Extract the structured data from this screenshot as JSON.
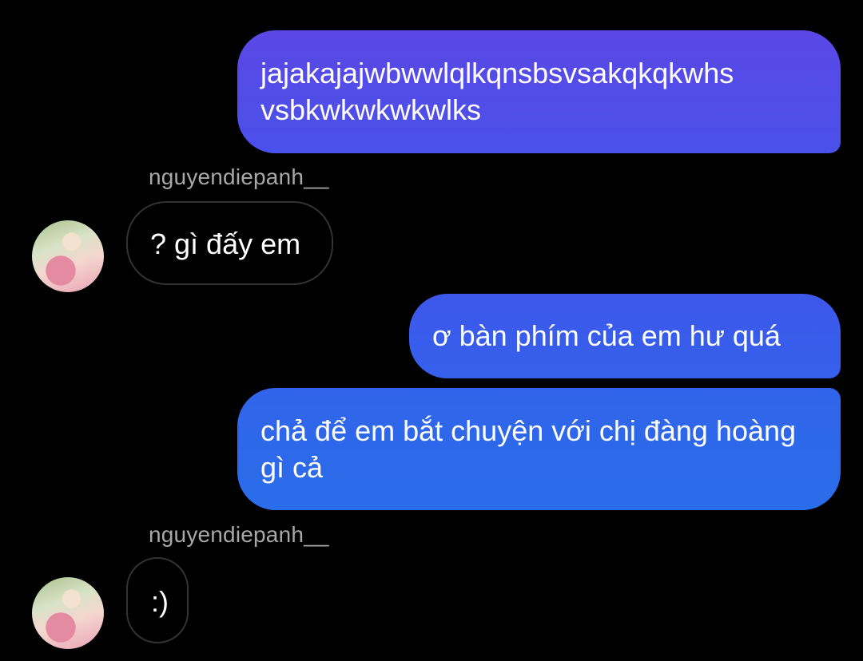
{
  "colors": {
    "background": "#000000",
    "sent_gradient_top": "#5a48e6",
    "sent_gradient_mid": "#3c57ec",
    "sent_gradient_bottom": "#2b6bea",
    "received_border": "#333336",
    "sender_name": "#a8a8a8",
    "text": "#ffffff"
  },
  "messages": [
    {
      "direction": "sent",
      "text": "jajakajajwbwwlqlkqnsbsvsakqkqkwhs vsbkwkwkwkwlks"
    },
    {
      "direction": "received",
      "sender": "nguyendiepanh__",
      "text": "? gì đấy em"
    },
    {
      "direction": "sent",
      "text": "ơ bàn phím của em hư quá"
    },
    {
      "direction": "sent",
      "text": "chả để em bắt chuyện với chị đàng hoàng gì cả"
    },
    {
      "direction": "received",
      "sender": "nguyendiepanh__",
      "text": ":)"
    }
  ],
  "icons": {
    "avatar": "profile-avatar"
  }
}
